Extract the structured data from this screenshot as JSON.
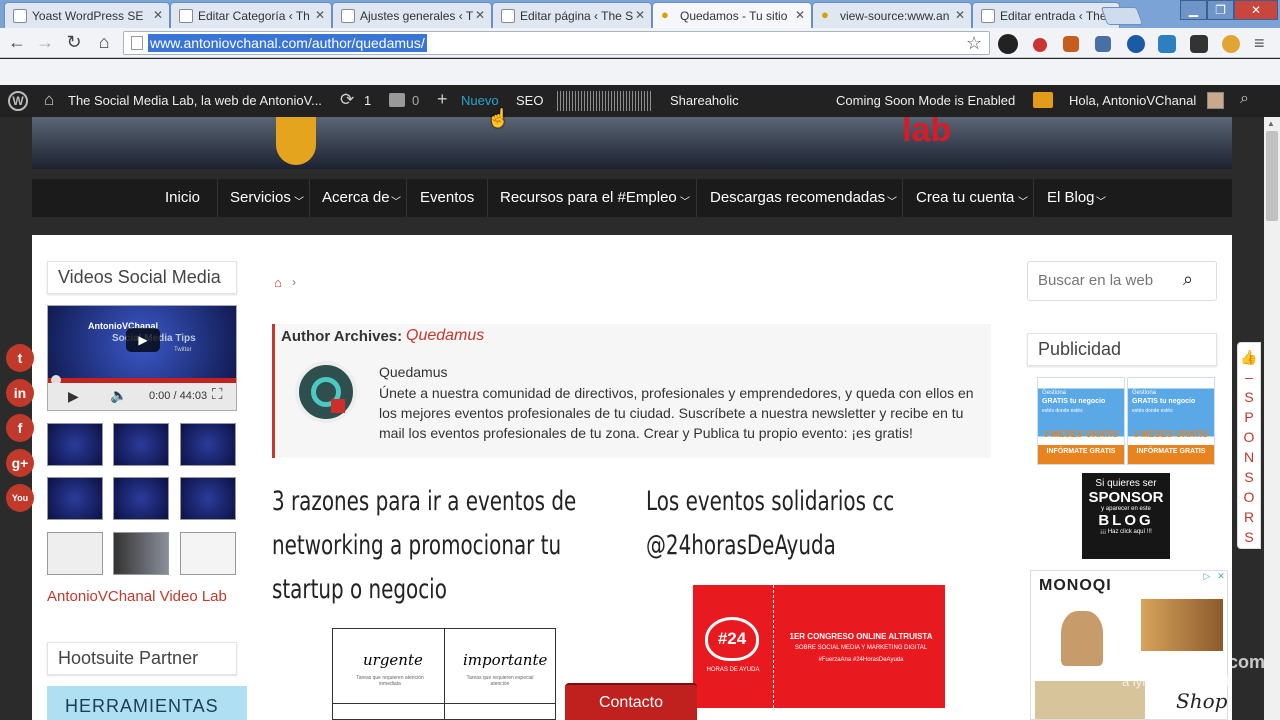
{
  "browser": {
    "tabs": [
      {
        "title": "Yoast WordPress SE",
        "active": false
      },
      {
        "title": "Editar Categoría ‹ Th",
        "active": false
      },
      {
        "title": "Ajustes generales ‹ T",
        "active": false
      },
      {
        "title": "Editar página ‹ The S",
        "active": false
      },
      {
        "title": "Quedamos - Tu sitio",
        "active": true
      },
      {
        "title": "view-source:www.an",
        "active": false
      },
      {
        "title": "Editar entrada ‹ The",
        "active": false
      }
    ],
    "url": "www.antoniovchanal.com/author/quedamus/"
  },
  "adminbar": {
    "site_name": "The Social Media Lab, la web de AntonioV...",
    "updates_count": "1",
    "comments_count": "0",
    "new_label": "Nuevo",
    "seo_label": "SEO",
    "shareaholic_label": "Shareaholic",
    "coming_soon": "Coming Soon Mode is Enabled",
    "greeting": "Hola, AntonioVChanal"
  },
  "header": {
    "logo_text": "lab"
  },
  "nav": {
    "items": [
      {
        "label": "Inicio",
        "dropdown": false
      },
      {
        "label": "Servicios",
        "dropdown": true
      },
      {
        "label": "Acerca de",
        "dropdown": true
      },
      {
        "label": "Eventos",
        "dropdown": false
      },
      {
        "label": "Recursos para el #Empleo",
        "dropdown": true
      },
      {
        "label": "Descargas recomendadas",
        "dropdown": true
      },
      {
        "label": "Crea tu cuenta",
        "dropdown": true
      },
      {
        "label": "El Blog",
        "dropdown": true
      }
    ]
  },
  "left_sidebar": {
    "videos_title": "Videos Social Media",
    "video": {
      "overlay_title": "AntonioVChanal",
      "overlay_sub": "Social Media Tips",
      "overlay_small": "Twitter",
      "time": "0:00 / 44:03"
    },
    "video_lab_link": "AntonioVChanal Video Lab",
    "hootsuite_title": "Hootsuite Partner",
    "hootsuite_banner": "HERRAMIENTAS"
  },
  "main": {
    "author_prefix": "Author Archives:",
    "author_name": "Quedamus",
    "author_box_name": "Quedamus",
    "author_bio": "Únete a nuestra comunidad de directivos, profesionales y emprendedores, y queda con ellos en los mejores eventos profesionales de tu ciudad. Suscríbete a nuestra newsletter y recibe en tu mail los eventos profesionales de tu zona. Crear y Publica tu propio evento: ¡es gratis!",
    "post1_title": "3 razones para ir a eventos de networking a promocionar tu startup o negocio",
    "post1_img": {
      "col1": "urgente",
      "col2": "importante",
      "col1_sub": "Tareas que requieren atención inmediata",
      "col2_sub": "Tareas que requieren especial atención"
    },
    "post2_title": "Los eventos solidarios cc @24horasDeAyuda",
    "post2_img": {
      "badge": "#24",
      "badge_sub": "HORAS DE AYUDA",
      "line1": "1ER CONGRESO ONLINE ALTRUISTA",
      "line2": "SOBRE SOCIAL MEDIA Y MARKETING DIGITAL",
      "line3": "#FuerzaAna  #24HorasDeAyuda"
    }
  },
  "right_sidebar": {
    "search_placeholder": "Buscar en la web",
    "ads_title": "Publicidad",
    "ad1": {
      "top": "Gestiona",
      "gratis": "GRATIS tu negocio",
      "small": "estés donde estés",
      "months": "3 MESES GRATIS",
      "cta": "INFÓRMATE GRATIS"
    },
    "sponsor_ad": {
      "line1": "Si quieres ser",
      "line2": "SPONSOR",
      "line3": "y aparecer en este",
      "line4": "BLOG",
      "line5": "¡¡¡ Haz click aquí !!!"
    },
    "monoqi_brand": "MONOQI",
    "shop": "Shop"
  },
  "sponsors_tab": {
    "letters": [
      "S",
      "P",
      "O",
      "N",
      "S",
      "O",
      "R",
      "S"
    ]
  },
  "contact_button": "Contacto",
  "watermark": {
    "line1": "video2brain.com",
    "line2": "a lynda.com brand"
  }
}
